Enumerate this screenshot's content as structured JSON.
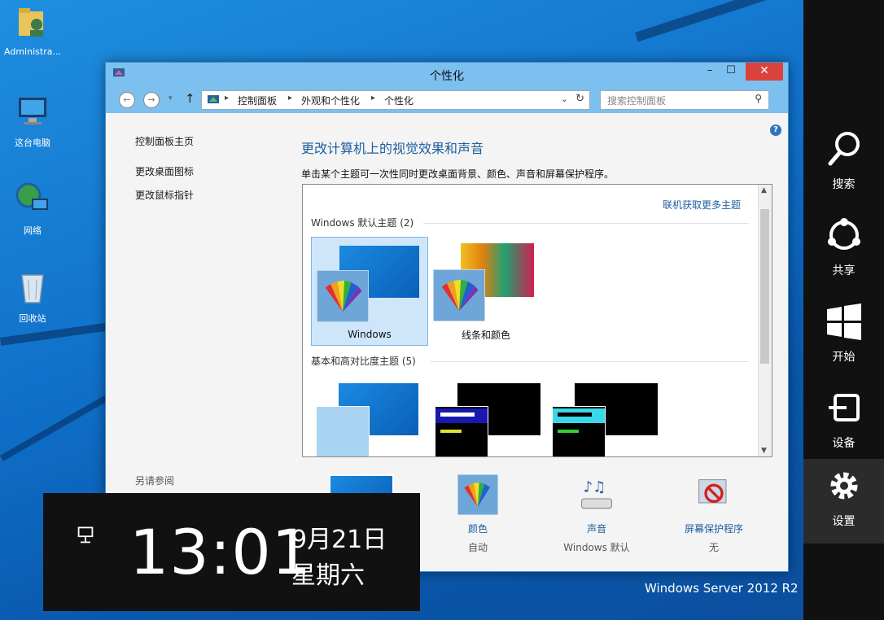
{
  "desktop_icons": [
    {
      "label": "Administra..."
    },
    {
      "label": "这台电脑"
    },
    {
      "label": "网络"
    },
    {
      "label": "回收站"
    }
  ],
  "window": {
    "title": "个性化",
    "breadcrumb": [
      "控制面板",
      "外观和个性化",
      "个性化"
    ],
    "search_placeholder": "搜索控制面板",
    "left_links": [
      "控制面板主页",
      "更改桌面图标",
      "更改鼠标指针"
    ],
    "see_also": "另请参阅",
    "heading": "更改计算机上的视觉效果和声音",
    "subheading": "单击某个主题可一次性同时更改桌面背景、颜色、声音和屏幕保护程序。",
    "online_link": "联机获取更多主题",
    "section_default": "Windows 默认主题 (2)",
    "section_basic": "基本和高对比度主题 (5)",
    "themes": [
      {
        "label": "Windows"
      },
      {
        "label": "线条和颜色"
      }
    ],
    "bottom": [
      {
        "label": "颜色",
        "value": "自动"
      },
      {
        "label": "声音",
        "value": "Windows 默认"
      },
      {
        "label": "屏幕保护程序",
        "value": "无"
      }
    ]
  },
  "charms": [
    {
      "label": "搜索"
    },
    {
      "label": "共享"
    },
    {
      "label": "开始"
    },
    {
      "label": "设备"
    },
    {
      "label": "设置"
    }
  ],
  "clock": {
    "time": "13:01",
    "date": "9月21日",
    "weekday": "星期六"
  },
  "watermark": "Windows Server 2012 R2",
  "colors": {
    "accent": "#1e5fa0",
    "titlebar": "#7cc0f0",
    "close": "#d9433b",
    "charms_bg": "#111111"
  }
}
